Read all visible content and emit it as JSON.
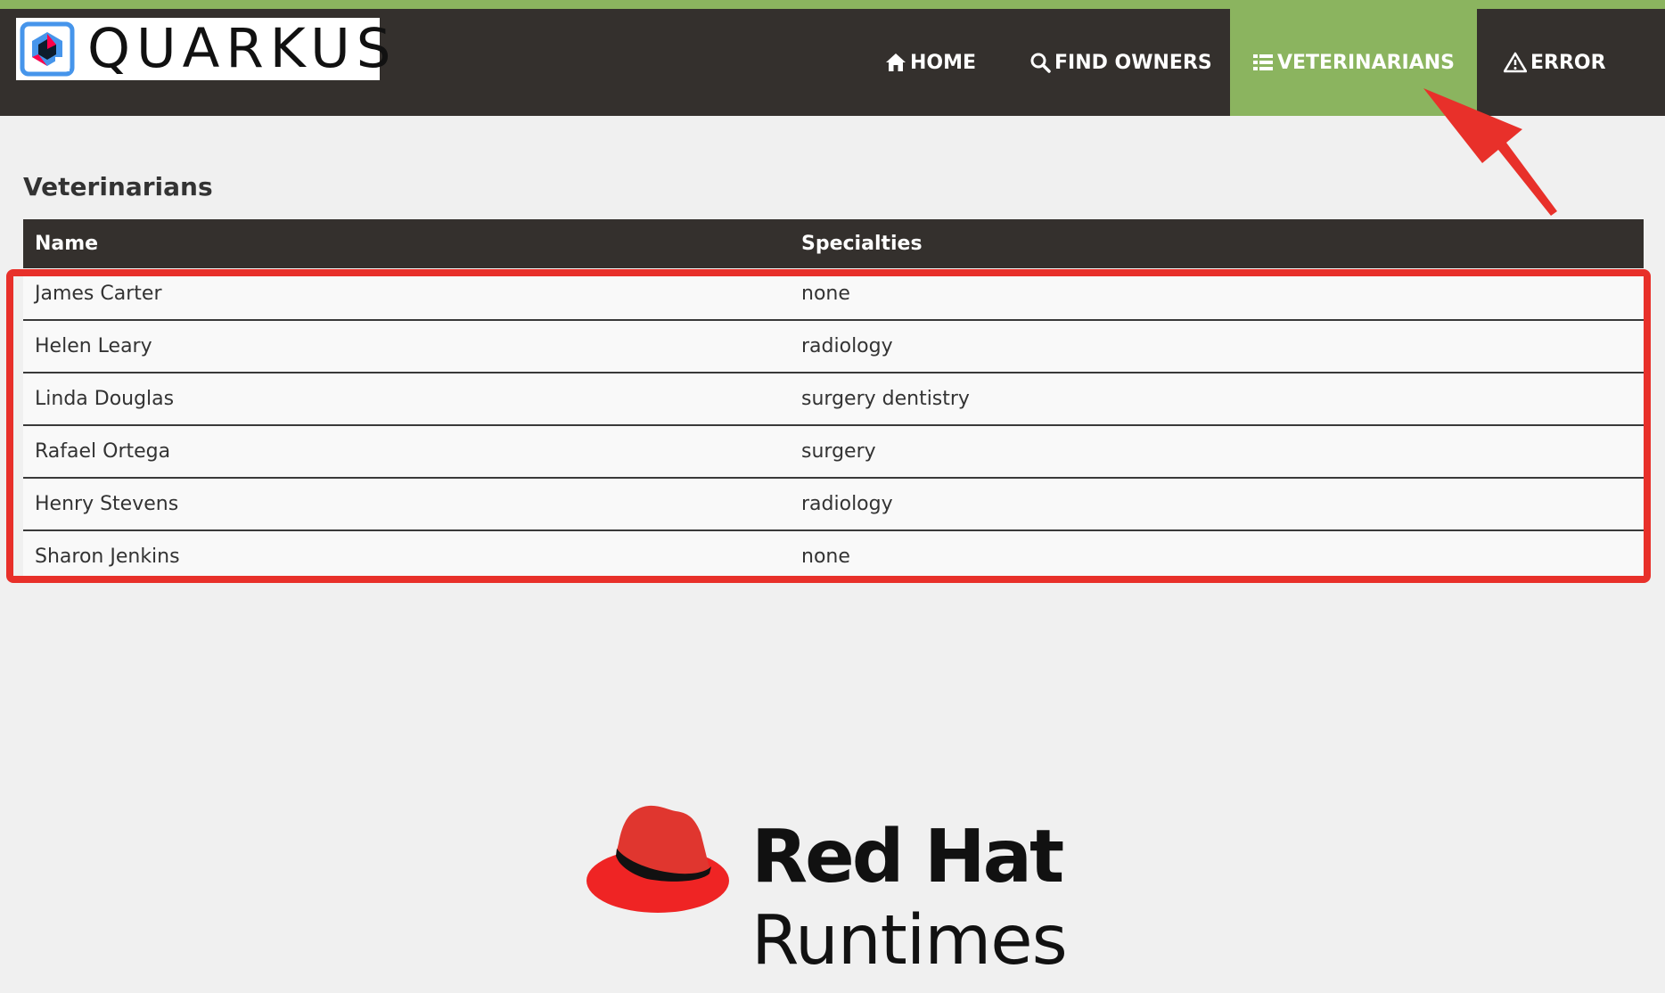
{
  "header": {
    "logo_text": "QUARKUS",
    "nav": [
      {
        "label": "HOME",
        "icon": "home-icon"
      },
      {
        "label": "FIND OWNERS",
        "icon": "search-icon"
      },
      {
        "label": "VETERINARIANS",
        "icon": "list-icon",
        "active": true
      },
      {
        "label": "ERROR",
        "icon": "warning-icon"
      }
    ]
  },
  "main": {
    "title": "Veterinarians",
    "columns": [
      "Name",
      "Specialties"
    ],
    "rows": [
      {
        "name": "James Carter",
        "specialties": "none"
      },
      {
        "name": "Helen Leary",
        "specialties": "radiology"
      },
      {
        "name": "Linda Douglas",
        "specialties": "surgery dentistry"
      },
      {
        "name": "Rafael Ortega",
        "specialties": "surgery"
      },
      {
        "name": "Henry Stevens",
        "specialties": "radiology"
      },
      {
        "name": "Sharon Jenkins",
        "specialties": "none"
      }
    ]
  },
  "footer": {
    "brand_line1": "Red Hat",
    "brand_line2": "Runtimes"
  },
  "colors": {
    "navbar": "#34302d",
    "accent_green": "#8bb45f",
    "annotation_red": "#e8302a",
    "background": "#f0f0f0"
  }
}
